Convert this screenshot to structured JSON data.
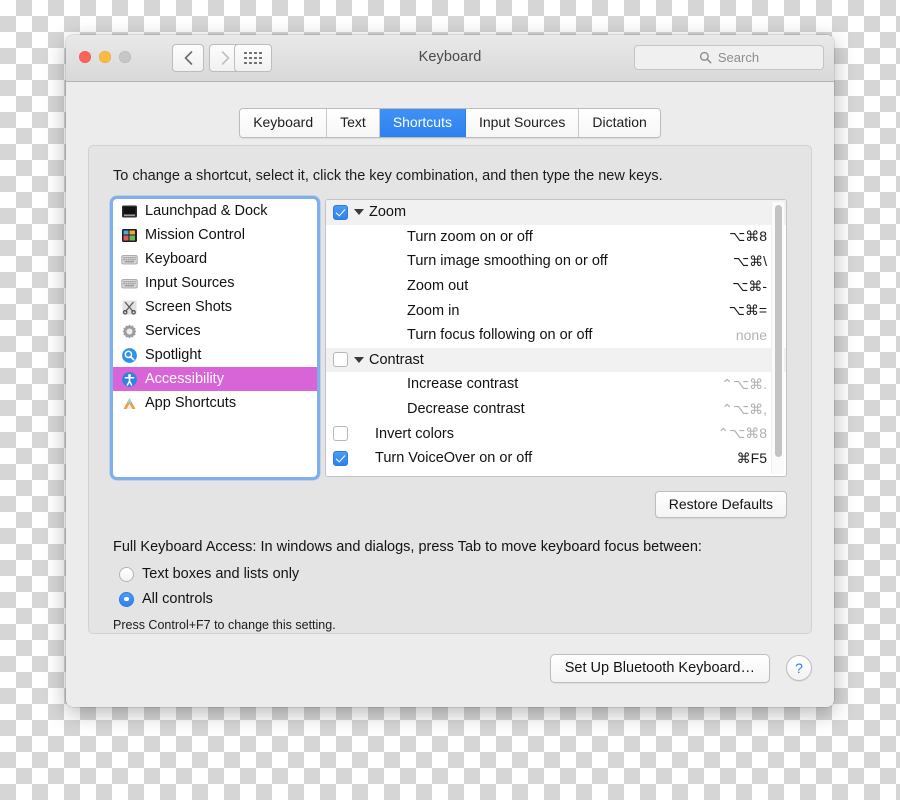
{
  "window": {
    "title": "Keyboard",
    "traffic_lights": [
      "close-red",
      "minimize-yellow",
      "zoom-disabled"
    ],
    "nav": {
      "back": "back-chevron",
      "forward": "forward-chevron",
      "grid": "show-all-grid"
    },
    "search": {
      "placeholder": "Search",
      "icon": "search-icon"
    }
  },
  "tabs": [
    {
      "label": "Keyboard",
      "active": false
    },
    {
      "label": "Text",
      "active": false
    },
    {
      "label": "Shortcuts",
      "active": true
    },
    {
      "label": "Input Sources",
      "active": false
    },
    {
      "label": "Dictation",
      "active": false
    }
  ],
  "hint": "To change a shortcut, select it, click the key combination, and then type the new keys.",
  "categories": [
    {
      "label": "Launchpad & Dock",
      "icon": "launchpad-dock-icon",
      "selected": false
    },
    {
      "label": "Mission Control",
      "icon": "mission-control-icon",
      "selected": false
    },
    {
      "label": "Keyboard",
      "icon": "keyboard-icon",
      "selected": false
    },
    {
      "label": "Input Sources",
      "icon": "input-sources-icon",
      "selected": false
    },
    {
      "label": "Screen Shots",
      "icon": "screenshots-icon",
      "selected": false
    },
    {
      "label": "Services",
      "icon": "services-gear-icon",
      "selected": false
    },
    {
      "label": "Spotlight",
      "icon": "spotlight-icon",
      "selected": false
    },
    {
      "label": "Accessibility",
      "icon": "accessibility-icon",
      "selected": true
    },
    {
      "label": "App Shortcuts",
      "icon": "app-shortcuts-icon",
      "selected": false
    }
  ],
  "shortcuts": [
    {
      "name": "Zoom",
      "keys": "",
      "checkbox": "checked",
      "type": "group"
    },
    {
      "name": "Turn zoom on or off",
      "keys": "⌥⌘8",
      "checkbox": "hidden",
      "type": "child"
    },
    {
      "name": "Turn image smoothing on or off",
      "keys": "⌥⌘\\",
      "checkbox": "hidden",
      "type": "child"
    },
    {
      "name": "Zoom out",
      "keys": "⌥⌘-",
      "checkbox": "hidden",
      "type": "child"
    },
    {
      "name": "Zoom in",
      "keys": "⌥⌘=",
      "checkbox": "hidden",
      "type": "child"
    },
    {
      "name": "Turn focus following on or off",
      "keys": "none",
      "checkbox": "hidden",
      "type": "child",
      "keystyle": "none"
    },
    {
      "name": "Contrast",
      "keys": "",
      "checkbox": "unchecked",
      "type": "group"
    },
    {
      "name": "Increase contrast",
      "keys": "⌃⌥⌘.",
      "checkbox": "hidden",
      "type": "child",
      "keystyle": "dim"
    },
    {
      "name": "Decrease contrast",
      "keys": "⌃⌥⌘,",
      "checkbox": "hidden",
      "type": "child",
      "keystyle": "dim"
    },
    {
      "name": "Invert colors",
      "keys": "⌃⌥⌘8",
      "checkbox": "unchecked",
      "type": "sub",
      "keystyle": "dim"
    },
    {
      "name": "Turn VoiceOver on or off",
      "keys": "⌘F5",
      "checkbox": "checked",
      "type": "sub"
    }
  ],
  "restore_defaults_label": "Restore Defaults",
  "full_keyboard_access": {
    "title": "Full Keyboard Access: In windows and dialogs, press Tab to move keyboard focus between:",
    "options": [
      {
        "label": "Text boxes and lists only",
        "selected": false
      },
      {
        "label": "All controls",
        "selected": true
      }
    ],
    "note": "Press Control+F7 to change this setting."
  },
  "footer": {
    "bluetooth_label": "Set Up Bluetooth Keyboard…",
    "help_label": "?"
  }
}
